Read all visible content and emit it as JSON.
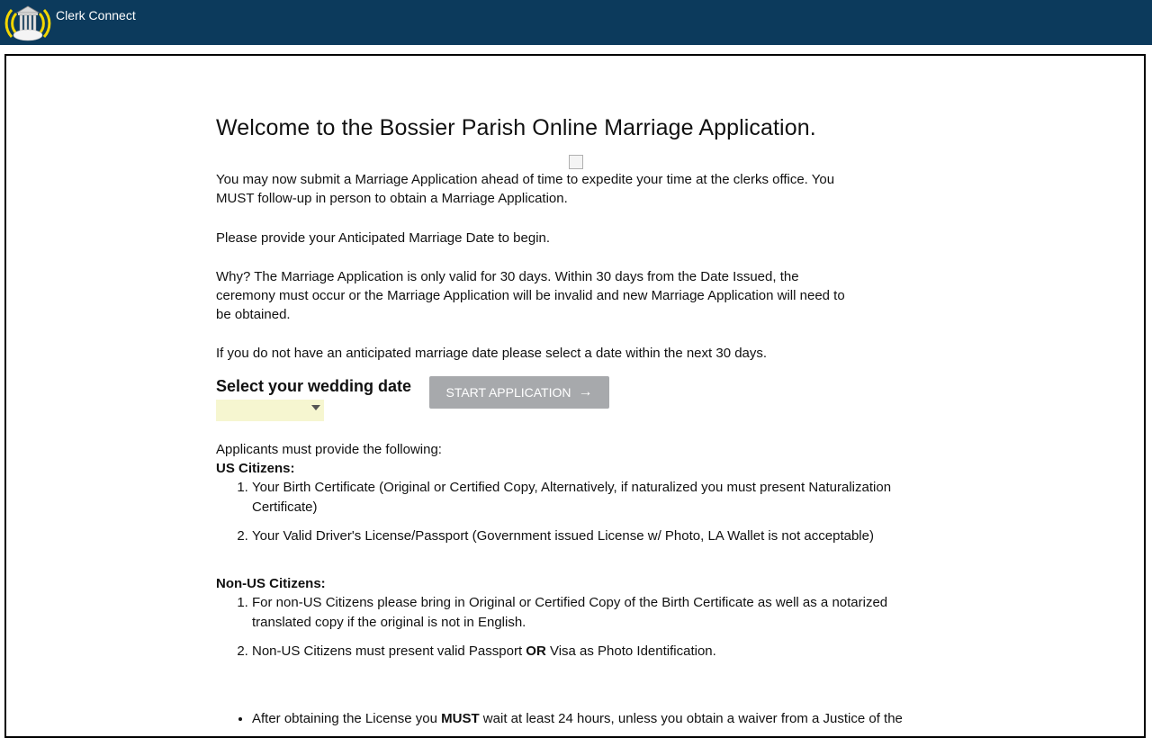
{
  "header": {
    "app_title": "Clerk Connect",
    "background_color": "#0c3a5c",
    "logo_icon": "courthouse-signal-icon"
  },
  "main": {
    "title": "Welcome to the Bossier Parish Online Marriage Application.",
    "intro": "You may now submit a Marriage Application ahead of time to expedite your time at the clerks office. You MUST follow-up in person to obtain a Marriage Application.",
    "prompt": "Please provide your Anticipated Marriage Date to begin.",
    "why": "Why? The Marriage Application is only valid for 30 days. Within 30 days from the Date Issued, the ceremony must occur or the Marriage Application will be invalid and new Marriage Application will need to be obtained.",
    "no_date": "If you do not have an anticipated marriage date please select a date within the next 30 days.",
    "select_label": "Select your wedding date",
    "date_value": "",
    "start_button": "START APPLICATION",
    "requirements_intro": "Applicants must provide the following:",
    "us_heading": "US Citizens:",
    "us_items": [
      "Your Birth Certificate (Original or Certified Copy, Alternatively, if naturalized you must present Naturalization Certificate)",
      "Your Valid Driver's License/Passport (Government issued License w/ Photo, LA Wallet is not acceptable)"
    ],
    "non_us_heading": "Non-US Citizens:",
    "non_us_item_1": "For non-US Citizens please bring in Original or Certified Copy of the Birth Certificate as well as a notarized translated copy if the original is not in English.",
    "non_us_item_2_a": "Non-US Citizens must present valid Passport ",
    "non_us_item_2_or": "OR",
    "non_us_item_2_b": " Visa as Photo Identification.",
    "note_a": "After obtaining the License you ",
    "note_must": "MUST",
    "note_b": " wait at least 24 hours, unless you obtain a waiver from a Justice of the"
  }
}
